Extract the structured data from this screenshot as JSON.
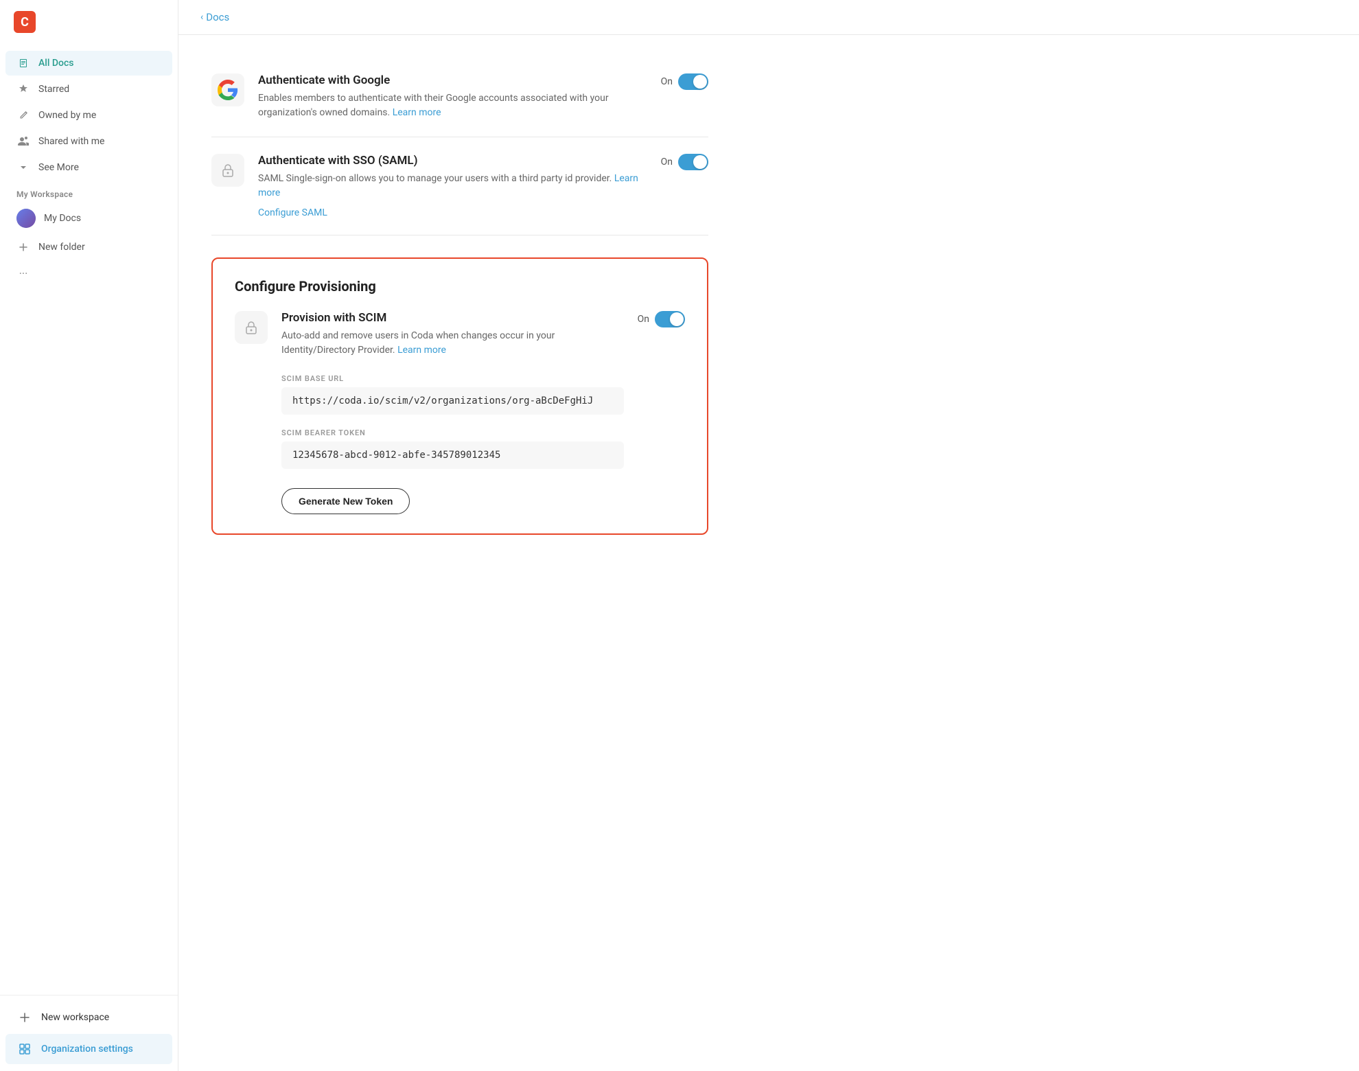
{
  "sidebar": {
    "logo_text": "C",
    "nav_items": [
      {
        "id": "all-docs",
        "label": "All Docs",
        "icon": "doc",
        "active": true
      },
      {
        "id": "starred",
        "label": "Starred",
        "icon": "star",
        "active": false
      },
      {
        "id": "owned-by-me",
        "label": "Owned by me",
        "icon": "pencil",
        "active": false
      },
      {
        "id": "shared-with-me",
        "label": "Shared with me",
        "icon": "people",
        "active": false
      },
      {
        "id": "see-more",
        "label": "See More",
        "icon": "chevron-down",
        "active": false
      }
    ],
    "workspace_section": "My Workspace",
    "workspace_items": [
      {
        "id": "my-docs",
        "label": "My Docs",
        "icon": "avatar",
        "active": false
      },
      {
        "id": "new-folder",
        "label": "New folder",
        "icon": "plus",
        "active": false
      },
      {
        "id": "more-options",
        "label": "...",
        "icon": "ellipsis",
        "active": false
      }
    ],
    "bottom_items": [
      {
        "id": "new-workspace",
        "label": "New workspace",
        "icon": "plus",
        "active": false
      },
      {
        "id": "org-settings",
        "label": "Organization settings",
        "icon": "grid",
        "active": true
      }
    ]
  },
  "header": {
    "back_label": "Docs"
  },
  "auth_google": {
    "title": "Authenticate with Google",
    "description": "Enables members to authenticate with their Google accounts associated with your organization's owned domains.",
    "learn_more_label": "Learn more",
    "toggle_label": "On",
    "toggle_on": true
  },
  "auth_sso": {
    "title": "Authenticate with SSO (SAML)",
    "description": "SAML Single-sign-on allows you to manage your users with a third party id provider.",
    "learn_more_label": "Learn more",
    "configure_label": "Configure SAML",
    "toggle_label": "On",
    "toggle_on": true
  },
  "provision": {
    "section_title": "Configure Provisioning",
    "title": "Provision with SCIM",
    "description": "Auto-add and remove users in Coda when changes occur in your Identity/Directory Provider.",
    "learn_more_label": "Learn more",
    "toggle_label": "On",
    "toggle_on": true,
    "scim_url_label": "SCIM Base URL",
    "scim_url_value": "https://coda.io/scim/v2/organizations/org-aBcDeFgHiJ",
    "bearer_token_label": "SCIM Bearer Token",
    "bearer_token_value": "12345678-abcd-9012-abfe-345789012345",
    "generate_btn_label": "Generate New Token"
  }
}
